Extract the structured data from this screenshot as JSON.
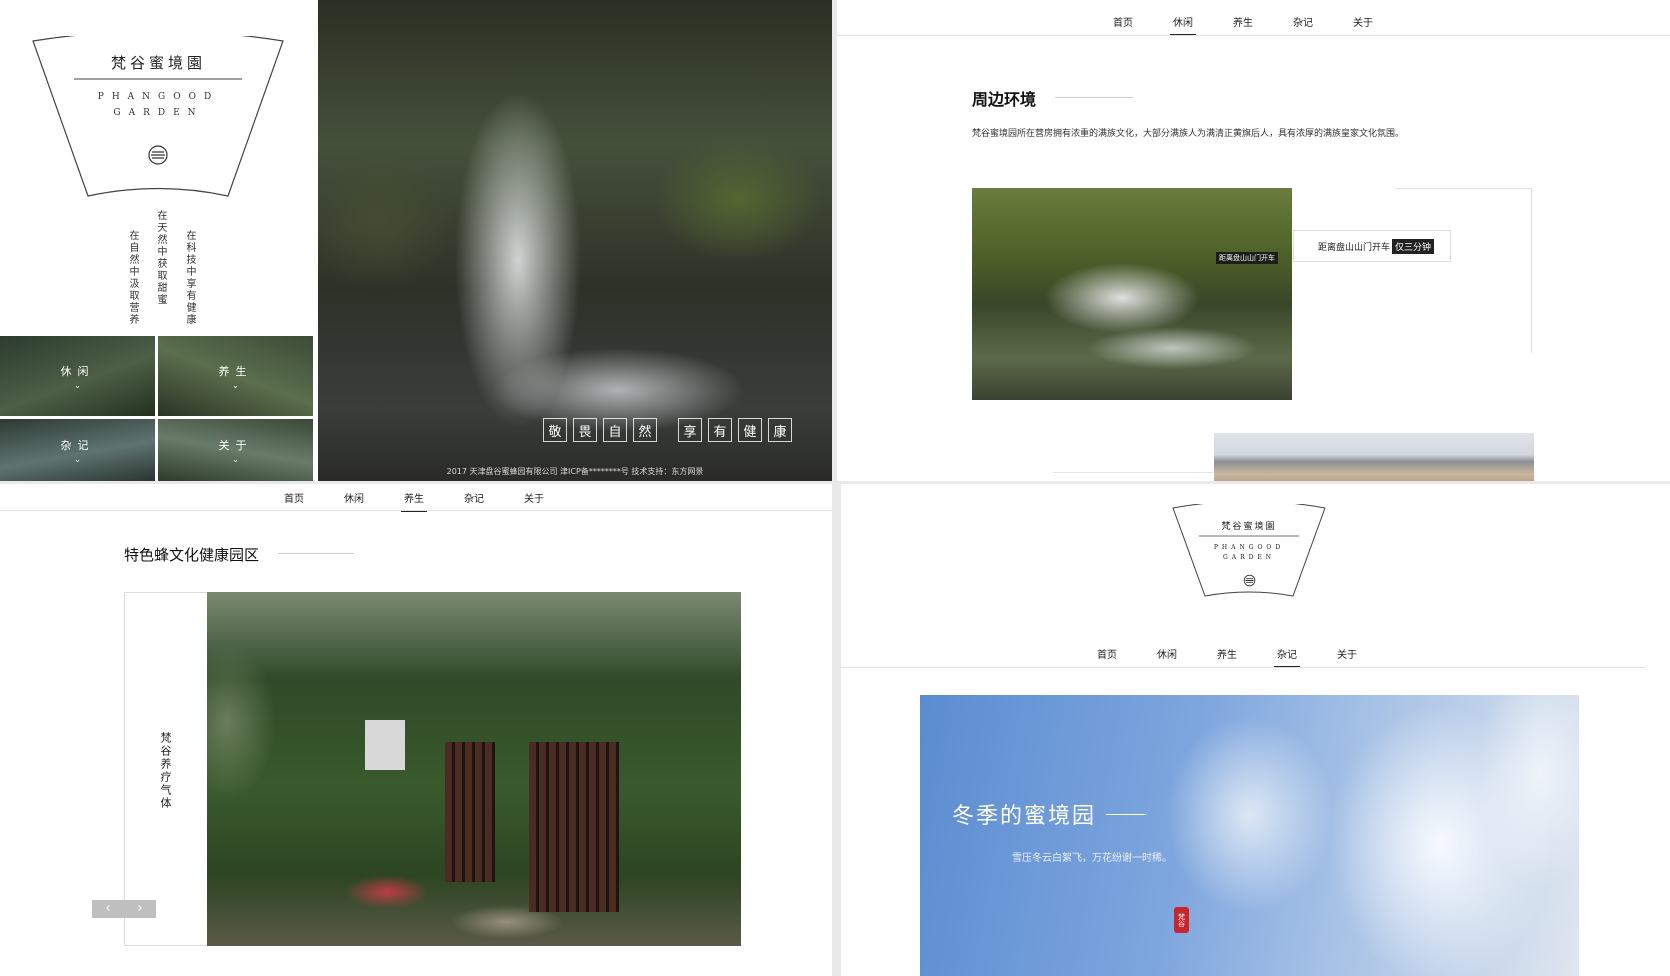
{
  "brand": {
    "name_cn": "梵谷蜜境園",
    "name_en_line1": "PHANGOOD",
    "name_en_line2": "GARDEN",
    "accent": "#222222"
  },
  "nav": [
    "首页",
    "休闲",
    "养生",
    "杂记",
    "关于"
  ],
  "q1": {
    "vertical_cols": [
      "在自然中汲取营养",
      "在天然中获取甜蜜",
      "在科技中享有健康"
    ],
    "tiles": [
      "休闲",
      "养生",
      "杂记",
      "关于"
    ],
    "motto_left": [
      "敬",
      "畏",
      "自",
      "然"
    ],
    "motto_right": [
      "享",
      "有",
      "健",
      "康"
    ],
    "footer": "2017 天津盘谷蜜蜂园有限公司 津ICP备********号 技术支持：东方网景"
  },
  "q2": {
    "active_nav": "休闲",
    "title": "周边环境",
    "desc": "梵谷蜜境园所在营房拥有浓重的满族文化，大部分满族人为满清正黄旗后人，具有浓厚的满族皇家文化氛围。",
    "callout_text": "距离盘山山门开车",
    "callout_tag": "仅三分钟",
    "tiny_label": "距离盘山山门开车"
  },
  "q3": {
    "active_nav": "养生",
    "title": "特色蜂文化健康园区",
    "side_text": "梵谷养疗气体",
    "prev": "‹",
    "next": "›"
  },
  "q4": {
    "active_nav": "杂记",
    "title": "冬季的蜜境园",
    "subtitle": "雪压冬云白絮飞，万花纷谢一时稀。",
    "seal": "梵谷"
  }
}
